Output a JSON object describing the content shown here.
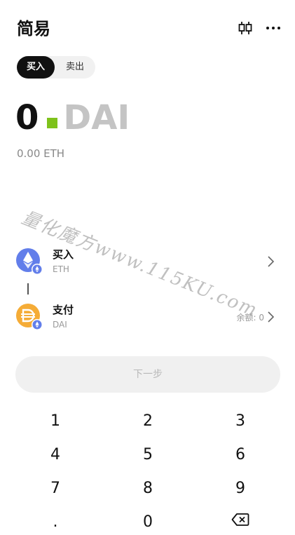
{
  "header": {
    "title": "简易",
    "chart_icon": "candlestick-icon",
    "more_icon": "more-icon"
  },
  "mode_toggle": {
    "buy_label": "买入",
    "sell_label": "卖出",
    "selected": "买入"
  },
  "amount": {
    "value": "0",
    "unit": "DAI",
    "cursor_color": "#7ec21b"
  },
  "equivalent": "0.00 ETH",
  "watermark": "量化魔方www.115KU.com",
  "buy_row": {
    "label": "买入",
    "token": "ETH",
    "icon": "eth-icon"
  },
  "pay_row": {
    "label": "支付",
    "token": "DAI",
    "balance_label": "余额: 0",
    "icon": "dai-icon"
  },
  "next_button": "下一步",
  "keypad": {
    "keys": [
      "1",
      "2",
      "3",
      "4",
      "5",
      "6",
      "7",
      "8",
      "9",
      ".",
      "0"
    ],
    "backspace_icon": "backspace-icon"
  },
  "colors": {
    "eth": "#627eea",
    "dai": "#f5ac37",
    "accent": "#7ec21b",
    "primary": "#111111"
  }
}
